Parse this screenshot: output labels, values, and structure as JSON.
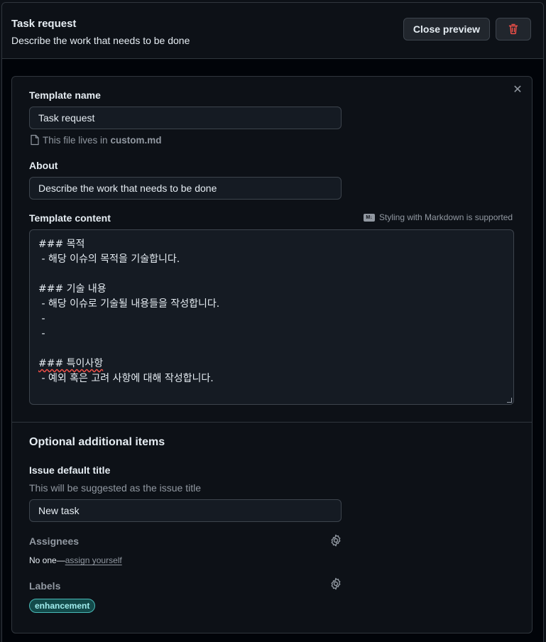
{
  "header": {
    "title": "Task request",
    "subtitle": "Describe the work that needs to be done",
    "close_preview_label": "Close preview",
    "delete_icon": "trash-icon"
  },
  "form": {
    "close_icon": "close-icon",
    "template_name": {
      "label": "Template name",
      "value": "Task request"
    },
    "file_note": {
      "prefix": "This file lives in",
      "filename": "custom.md",
      "icon": "file-icon"
    },
    "about": {
      "label": "About",
      "value": "Describe the work that needs to be done"
    },
    "template_content": {
      "label": "Template content",
      "markdown_note": "Styling with Markdown is supported",
      "markdown_icon": "markdown-icon",
      "lines": [
        "### 목적",
        " - 해당 이슈의 목적을 기술합니다.",
        "",
        "### 기술 내용",
        " - 해당 이슈로 기술될 내용들을 작성합니다.",
        " -",
        " -",
        "",
        "### 특이사항",
        " - 예외 혹은 고려 사항에 대해 작성합니다."
      ]
    }
  },
  "optional": {
    "section_title": "Optional additional items",
    "issue_title": {
      "label": "Issue default title",
      "hint": "This will be suggested as the issue title",
      "value": "New task"
    },
    "assignees": {
      "label": "Assignees",
      "gear_icon": "gear-icon",
      "none_text": "No one—",
      "assign_link": "assign yourself"
    },
    "labels": {
      "label": "Labels",
      "gear_icon": "gear-icon",
      "items": [
        "enhancement"
      ]
    }
  },
  "colors": {
    "background": "#0d1117",
    "border": "#30363d",
    "label_chip_bg": "#134a4a",
    "label_chip_text": "#a2eeef",
    "danger": "#f85149"
  }
}
